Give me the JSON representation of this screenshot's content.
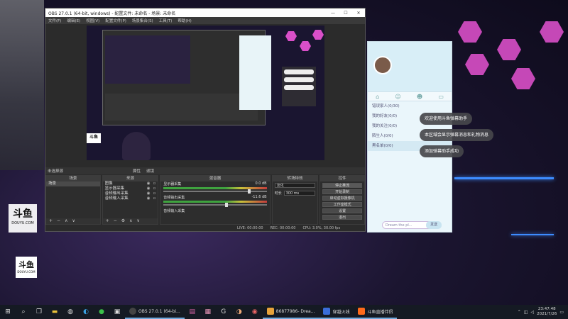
{
  "obs": {
    "title": "OBS 27.0.1 (64-bit, windows) - 配置文件: 未命名 - 场景: 未命名",
    "menu": [
      "文件(F)",
      "编辑(E)",
      "视图(V)",
      "配置文件(P)",
      "场景集合(S)",
      "工具(T)",
      "帮助(H)"
    ],
    "window_controls": [
      "—",
      "☐",
      "✕"
    ],
    "scene_bar": {
      "label": "未选择源",
      "properties": "属性",
      "filters": "滤镜"
    },
    "docks": {
      "scenes": {
        "title": "场景",
        "items": [
          "场景"
        ]
      },
      "sources": {
        "title": "来源",
        "items": [
          "图像",
          "显示器采集",
          "音频输出采集",
          "音频输入采集"
        ]
      },
      "mixer": {
        "title": "混音器",
        "channels": [
          {
            "name": "显示器采集",
            "db": "0.0 dB",
            "level": 0.82
          },
          {
            "name": "音频输出采集",
            "db": "-11.6 dB",
            "level": 0.6
          },
          {
            "name": "音频输入采集",
            "db": "",
            "level": 0.35
          }
        ]
      },
      "transitions": {
        "title": "转场特效",
        "type": "淡化",
        "duration_label": "时长",
        "duration": "300 ms"
      },
      "controls": {
        "title": "控件",
        "buttons": [
          "停止推流",
          "开始录制",
          "启动虚拟摄像机",
          "工作室模式",
          "设置",
          "退出"
        ]
      }
    },
    "status": {
      "live": "LIVE: 00:00:00",
      "rec": "REC: 00:00:00",
      "cpu": "CPU: 3.0%, 30.00 fps"
    }
  },
  "desktop": {
    "logo_top": {
      "brand": "斗鱼",
      "sub": "DOUYU.COM"
    },
    "logo_bottom": {
      "brand": "斗鱼",
      "sub": "DOUYU.COM"
    },
    "preview_mark": "斗鱼"
  },
  "chat": {
    "list": [
      "错误家人(0/30)",
      "我的好友(0/0)",
      "我的关注(0/0)",
      "陌生人(0/0)",
      "黑名单(0/0)"
    ],
    "input_placeholder": "Dream the pl...",
    "send_label": "发送",
    "bubbles": [
      "欢迎使用斗鱼弹幕助手",
      "本区域会显示弹幕消息和礼物消息",
      "添加弹幕助手成功"
    ]
  },
  "taskbar": {
    "apps": [
      {
        "label": "OBS 27.0.1 (64-bi...",
        "color": "#444"
      },
      {
        "label": "86877986- Drea...",
        "color": "#e8a33b"
      },
      {
        "label": "穿越火线",
        "color": "#3a6dd8"
      },
      {
        "label": "斗鱼直播伴侣",
        "color": "#ff6a1a"
      }
    ],
    "time": "23:47:48",
    "date": "2021/7/26"
  }
}
